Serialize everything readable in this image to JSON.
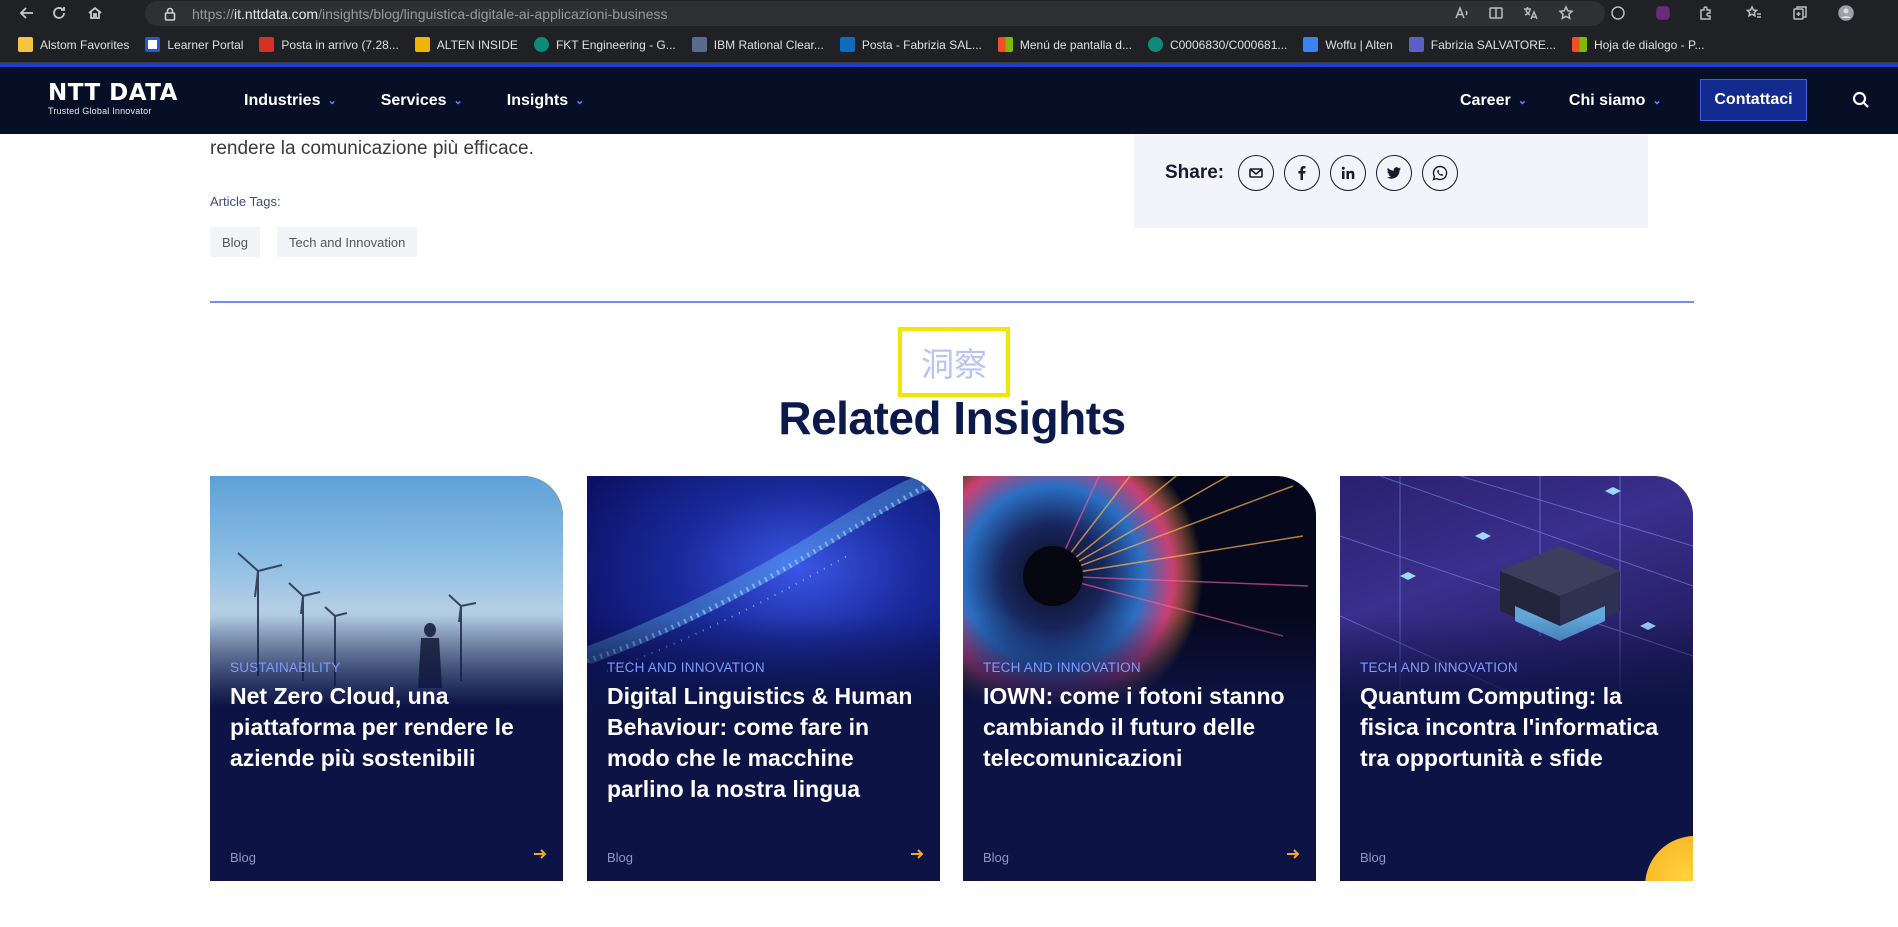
{
  "browser": {
    "url_scheme": "https://",
    "url_host": "it.nttdata.com",
    "url_path": "/insights/blog/linguistica-digitale-ai-applicazioni-business",
    "bookmarks": [
      {
        "label": "Alstom Favorites",
        "color": "#f5c542"
      },
      {
        "label": "Learner Portal",
        "color": "#1e5bd7"
      },
      {
        "label": "Posta in arrivo (7.28...",
        "color": "#d93025"
      },
      {
        "label": "ALTEN INSIDE",
        "color": "#f2b400"
      },
      {
        "label": "FKT Engineering - G...",
        "color": "#0f8a78"
      },
      {
        "label": "IBM Rational Clear...",
        "color": "#5a6b8c"
      },
      {
        "label": "Posta - Fabrizia SAL...",
        "color": "#0f6cbd"
      },
      {
        "label": "Menú de pantalla d...",
        "color": "#f25022"
      },
      {
        "label": "C0006830/C000681...",
        "color": "#0f8a78"
      },
      {
        "label": "Woffu | Alten",
        "color": "#3b82f6"
      },
      {
        "label": "Fabrizia SALVATORE...",
        "color": "#5b5fc7"
      },
      {
        "label": "Hoja de dialogo - P...",
        "color": "#f25022"
      }
    ]
  },
  "header": {
    "logo_main": "NTT DATA",
    "logo_sub": "Trusted Global Innovator",
    "nav_left": [
      "Industries",
      "Services",
      "Insights"
    ],
    "nav_right": [
      "Career",
      "Chi siamo"
    ],
    "contact_label": "Contattaci"
  },
  "article": {
    "intro_text": "rendere la comunicazione più efficace.",
    "tags_label": "Article Tags:",
    "tags": [
      "Blog",
      "Tech and Innovation"
    ],
    "share_label": "Share:"
  },
  "related": {
    "kanji": "洞察",
    "title": "Related Insights",
    "cards": [
      {
        "category": "SUSTAINABILITY",
        "title": "Net Zero Cloud, una piattaforma per rendere le aziende più sostenibili",
        "type": "Blog"
      },
      {
        "category": "TECH AND INNOVATION",
        "title": "Digital Linguistics & Human Behaviour: come fare in modo che le macchine parlino la nostra lingua",
        "type": "Blog"
      },
      {
        "category": "TECH AND INNOVATION",
        "title": "IOWN: come i fotoni stanno cambiando il futuro delle telecomunicazioni",
        "type": "Blog"
      },
      {
        "category": "TECH AND INNOVATION",
        "title": "Quantum Computing: la fisica incontra l'informatica tra opportunità e sfide",
        "type": "Blog"
      }
    ]
  },
  "colors": {
    "header_bg": "#070f26",
    "accent_blue": "#1d3dd1",
    "card_bg": "#0d1445",
    "category": "#7e9cff",
    "arrow": "#f5a623"
  }
}
